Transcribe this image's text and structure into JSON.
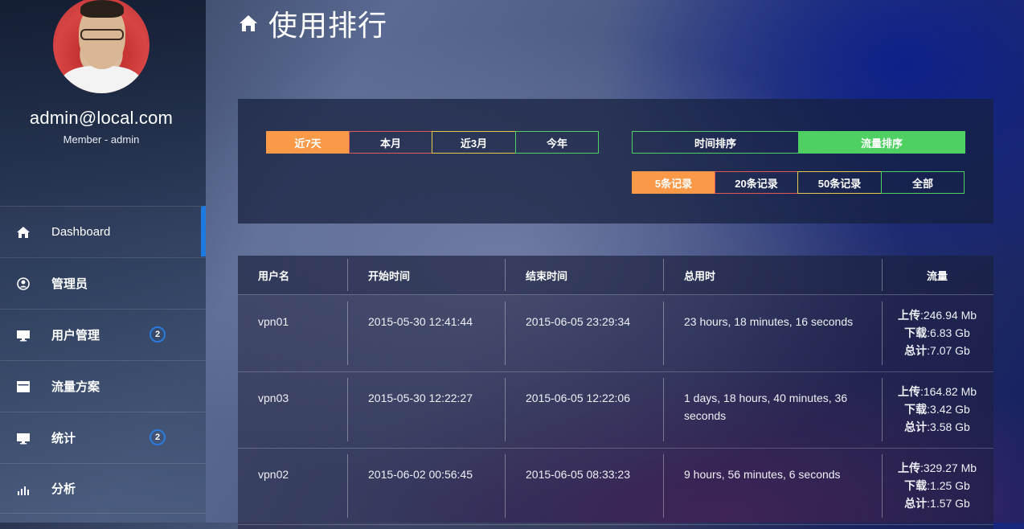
{
  "profile": {
    "email": "admin@local.com",
    "role": "Member - admin"
  },
  "nav": [
    {
      "label": "Dashboard",
      "icon": "home-icon",
      "active": true,
      "badge": ""
    },
    {
      "label": "管理员",
      "icon": "user-circle-icon",
      "active": false,
      "badge": ""
    },
    {
      "label": "用户管理",
      "icon": "monitor-icon",
      "active": false,
      "badge": "2"
    },
    {
      "label": "流量方案",
      "icon": "calendar-icon",
      "active": false,
      "badge": ""
    },
    {
      "label": "统计",
      "icon": "monitor-icon",
      "active": false,
      "badge": "2"
    },
    {
      "label": "分析",
      "icon": "bar-chart-icon",
      "active": false,
      "badge": ""
    }
  ],
  "page": {
    "title": "使用排行"
  },
  "filters": {
    "period": [
      "近7天",
      "本月",
      "近3月",
      "今年"
    ],
    "period_selected": "近7天",
    "sort": [
      "时间排序",
      "流量排序"
    ],
    "sort_selected": "流量排序",
    "limit": [
      "5条记录",
      "20条记录",
      "50条记录",
      "全部"
    ],
    "limit_selected": "5条记录"
  },
  "table": {
    "headers": [
      "用户名",
      "开始时间",
      "结束时间",
      "总用时",
      "流量"
    ],
    "traffic_labels": {
      "upload": "上传",
      "download": "下载",
      "total": "总计"
    },
    "rows": [
      {
        "user": "vpn01",
        "start": "2015-05-30 12:41:44",
        "end": "2015-06-05 23:29:34",
        "duration": "23 hours, 18 minutes, 16 seconds",
        "upload": ":246.94 Mb",
        "download": ":6.83 Gb",
        "total": ":7.07 Gb"
      },
      {
        "user": "vpn03",
        "start": "2015-05-30 12:22:27",
        "end": "2015-06-05 12:22:06",
        "duration": "1 days, 18 hours, 40 minutes, 36 seconds",
        "upload": ":164.82 Mb",
        "download": ":3.42 Gb",
        "total": ":3.58 Gb"
      },
      {
        "user": "vpn02",
        "start": "2015-06-02 00:56:45",
        "end": "2015-06-05 08:33:23",
        "duration": "9 hours, 56 minutes, 6 seconds",
        "upload": ":329.27 Mb",
        "download": ":1.25 Gb",
        "total": ":1.57 Gb"
      }
    ]
  },
  "colors": {
    "accent_orange": "#fa9a48",
    "accent_green": "#4fd063",
    "active_bar": "#1d7ae0"
  }
}
